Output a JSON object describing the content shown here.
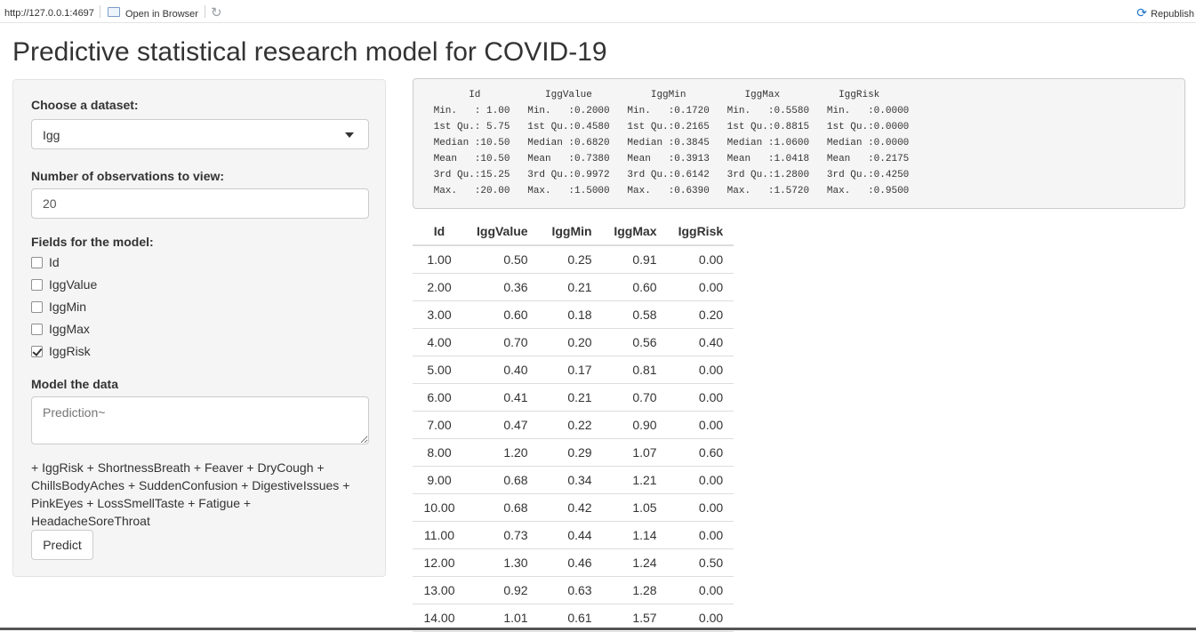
{
  "topbar": {
    "url": "http://127.0.0.1:4697",
    "open_in_browser": "Open in Browser",
    "republish": "Republish"
  },
  "title": "Predictive statistical research model for COVID-19",
  "sidebar": {
    "dataset_label": "Choose a dataset:",
    "dataset_value": "Igg",
    "obs_label": "Number of observations to view:",
    "obs_value": "20",
    "fields_label": "Fields for the model:",
    "fields": [
      {
        "label": "Id",
        "checked": false
      },
      {
        "label": "IggValue",
        "checked": false
      },
      {
        "label": "IggMin",
        "checked": false
      },
      {
        "label": "IggMax",
        "checked": false
      },
      {
        "label": "IggRisk",
        "checked": true
      }
    ],
    "model_label": "Model the data",
    "model_placeholder": "Prediction~",
    "formula": "+ IggRisk + ShortnessBreath + Feaver + DryCough + ChillsBodyAches + SuddenConfusion + DigestiveIssues + PinkEyes + LossSmellTaste + Fatigue + HeadacheSoreThroat",
    "predict_label": "Predict"
  },
  "summary": "       Id           IggValue          IggMin          IggMax          IggRisk     \n Min.   : 1.00   Min.   :0.2000   Min.   :0.1720   Min.   :0.5580   Min.   :0.0000  \n 1st Qu.: 5.75   1st Qu.:0.4580   1st Qu.:0.2165   1st Qu.:0.8815   1st Qu.:0.0000  \n Median :10.50   Median :0.6820   Median :0.3845   Median :1.0600   Median :0.0000  \n Mean   :10.50   Mean   :0.7380   Mean   :0.3913   Mean   :1.0418   Mean   :0.2175  \n 3rd Qu.:15.25   3rd Qu.:0.9972   3rd Qu.:0.6142   3rd Qu.:1.2800   3rd Qu.:0.4250  \n Max.   :20.00   Max.   :1.5000   Max.   :0.6390   Max.   :1.5720   Max.   :0.9500  ",
  "table": {
    "headers": [
      "Id",
      "IggValue",
      "IggMin",
      "IggMax",
      "IggRisk"
    ],
    "rows": [
      [
        "1.00",
        "0.50",
        "0.25",
        "0.91",
        "0.00"
      ],
      [
        "2.00",
        "0.36",
        "0.21",
        "0.60",
        "0.00"
      ],
      [
        "3.00",
        "0.60",
        "0.18",
        "0.58",
        "0.20"
      ],
      [
        "4.00",
        "0.70",
        "0.20",
        "0.56",
        "0.40"
      ],
      [
        "5.00",
        "0.40",
        "0.17",
        "0.81",
        "0.00"
      ],
      [
        "6.00",
        "0.41",
        "0.21",
        "0.70",
        "0.00"
      ],
      [
        "7.00",
        "0.47",
        "0.22",
        "0.90",
        "0.00"
      ],
      [
        "8.00",
        "1.20",
        "0.29",
        "1.07",
        "0.60"
      ],
      [
        "9.00",
        "0.68",
        "0.34",
        "1.21",
        "0.00"
      ],
      [
        "10.00",
        "0.68",
        "0.42",
        "1.05",
        "0.00"
      ],
      [
        "11.00",
        "0.73",
        "0.44",
        "1.14",
        "0.00"
      ],
      [
        "12.00",
        "1.30",
        "0.46",
        "1.24",
        "0.50"
      ],
      [
        "13.00",
        "0.92",
        "0.63",
        "1.28",
        "0.00"
      ],
      [
        "14.00",
        "1.01",
        "0.61",
        "1.57",
        "0.00"
      ]
    ]
  }
}
